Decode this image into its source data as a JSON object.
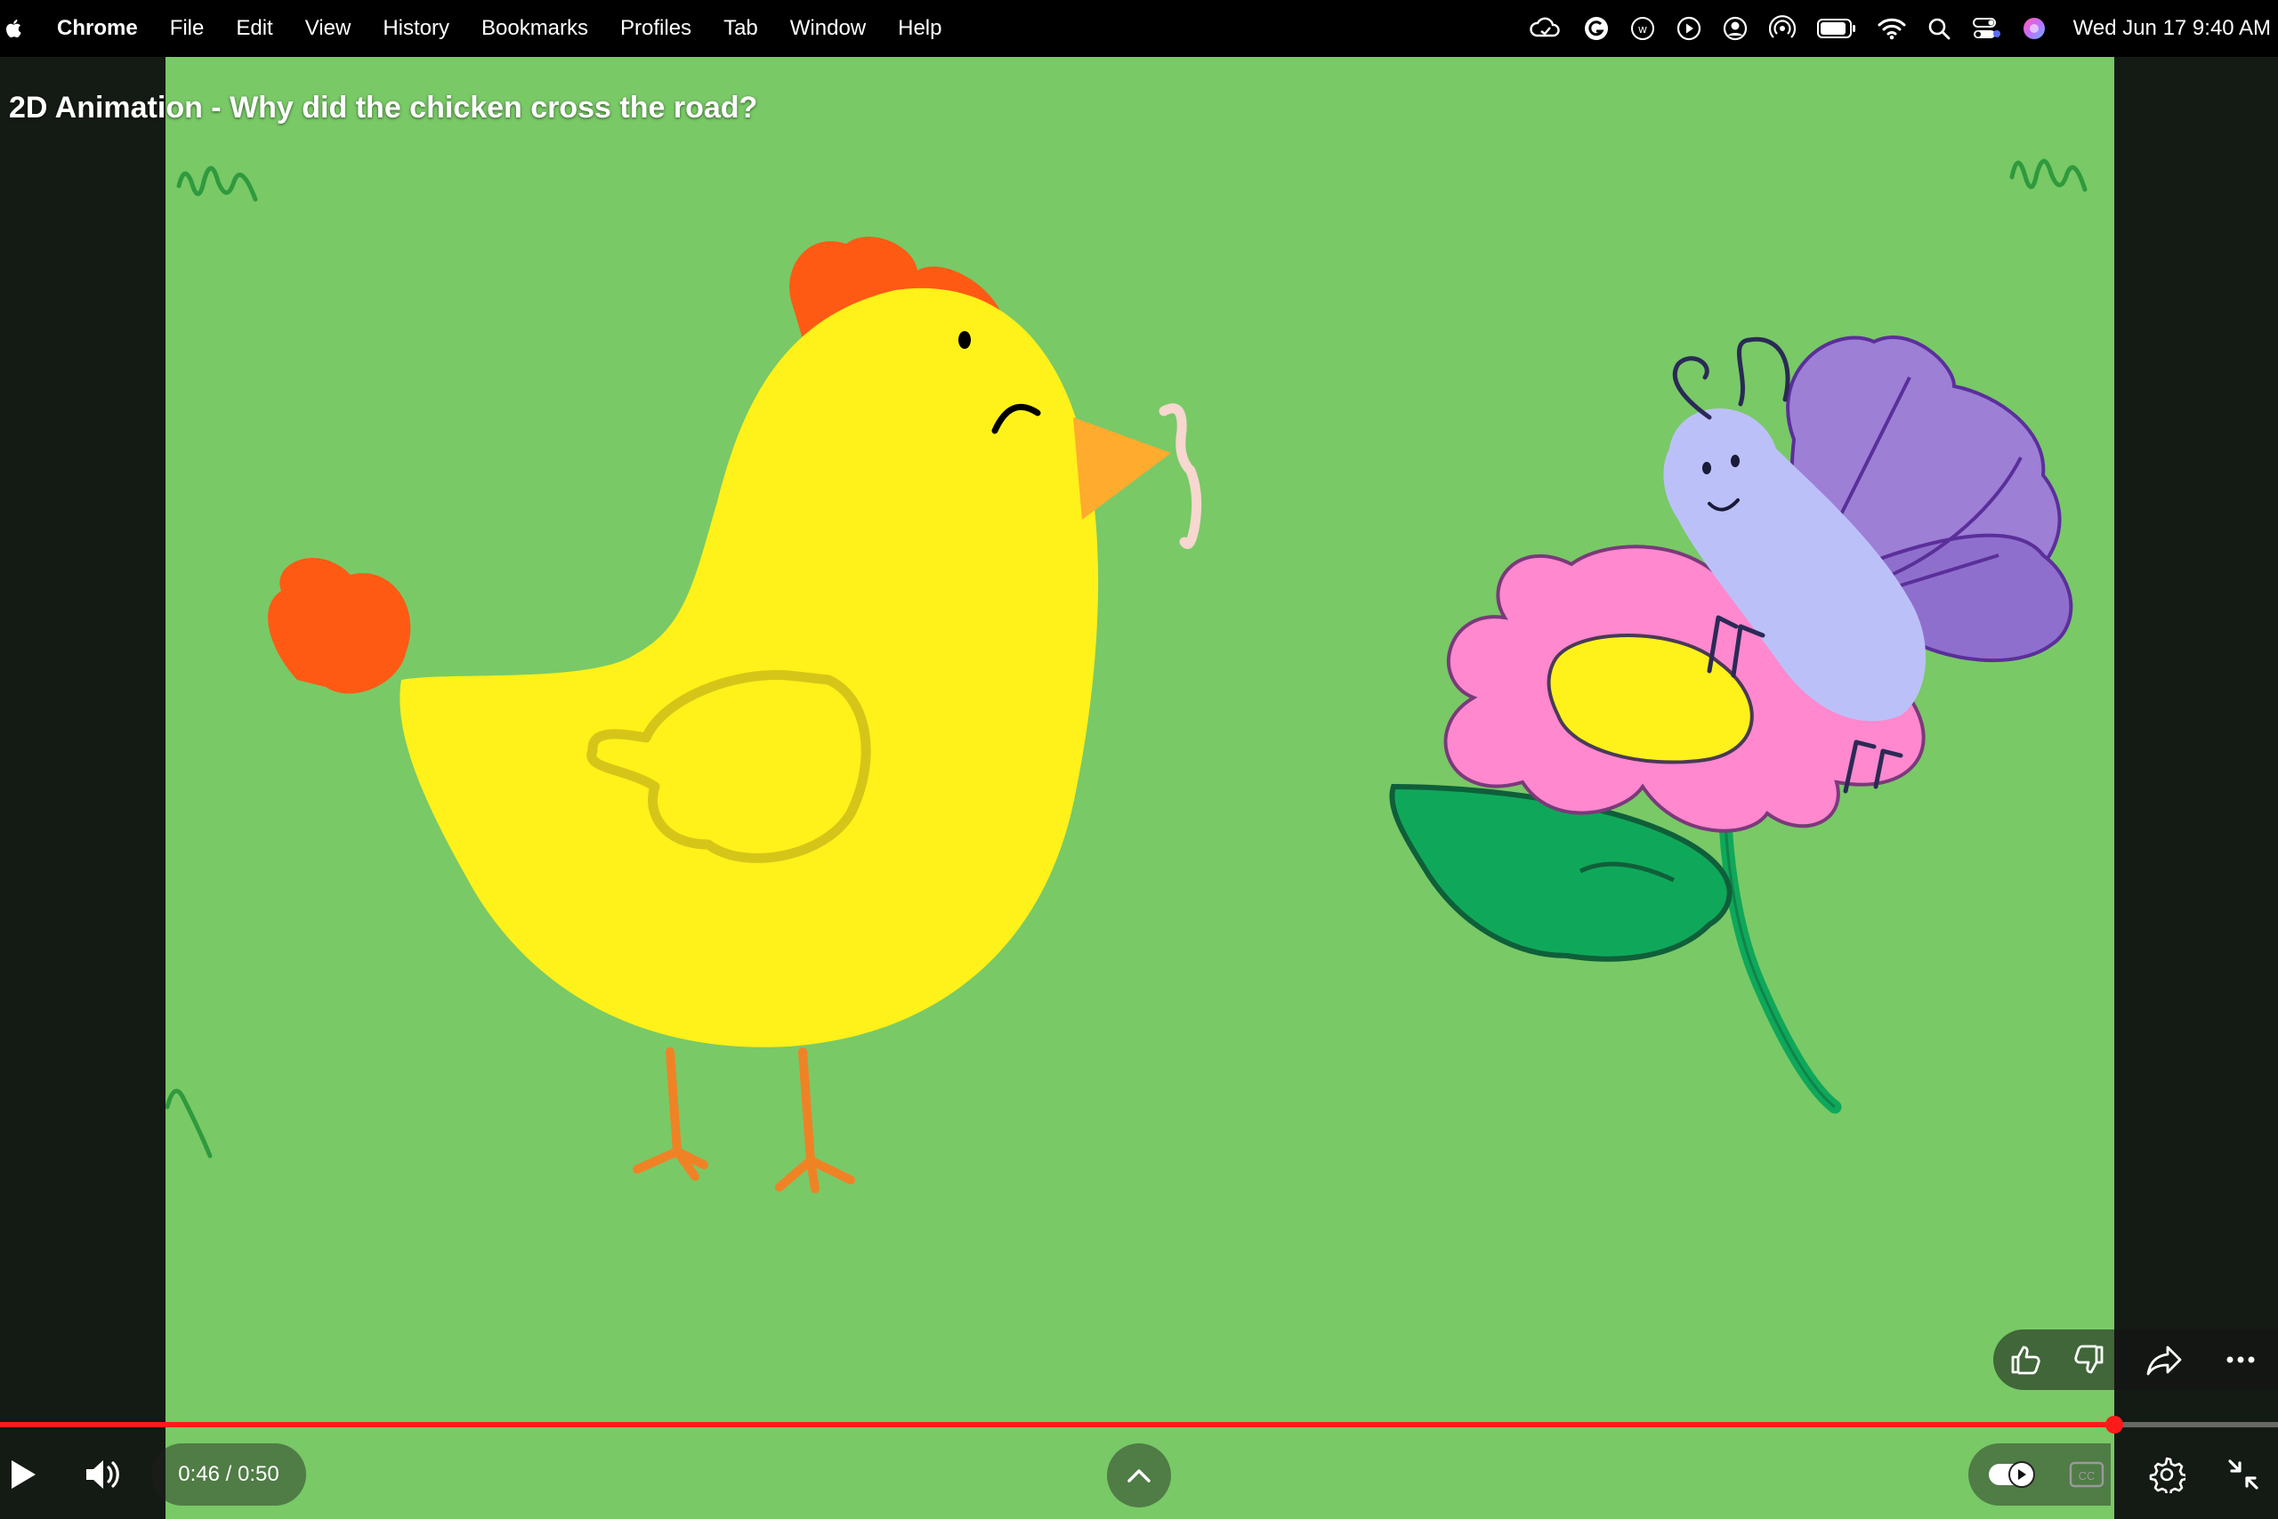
{
  "menubar": {
    "app_name": "Chrome",
    "menus": [
      "File",
      "Edit",
      "View",
      "History",
      "Bookmarks",
      "Profiles",
      "Tab",
      "Window",
      "Help"
    ],
    "clock": "Wed Jun 17  9:40 AM",
    "status_icons": [
      "cloud-sync-icon",
      "grammarly-icon",
      "w-circle-icon",
      "play-circle-icon",
      "user-circle-icon",
      "airdrop-icon",
      "battery-icon",
      "wifi-icon",
      "spotlight-search-icon",
      "control-center-icon",
      "siri-icon"
    ]
  },
  "video": {
    "title": "2D Animation - Why did the chicken cross the road?",
    "current_time": "0:46",
    "duration": "0:50",
    "time_display": "0:46 / 0:50",
    "progress_fraction": 0.928,
    "accent_color": "#ff1a1a"
  },
  "actions": {
    "icons": [
      "like-icon",
      "dislike-icon",
      "share-icon",
      "more-icon"
    ]
  },
  "controls": {
    "icons": [
      "play-icon",
      "volume-icon",
      "chevron-up-icon",
      "autoplay-toggle-icon",
      "captions-icon",
      "settings-icon",
      "exit-fullscreen-icon"
    ]
  },
  "scene_colors": {
    "grass": "#79c967",
    "chicken_body": "#fff11a",
    "comb": "#ff5a14",
    "butterfly_body": "#bcc0f8",
    "butterfly_wings": "#9d7fd6",
    "flower_petals": "#ff88cf",
    "leaf": "#0fa85a"
  }
}
